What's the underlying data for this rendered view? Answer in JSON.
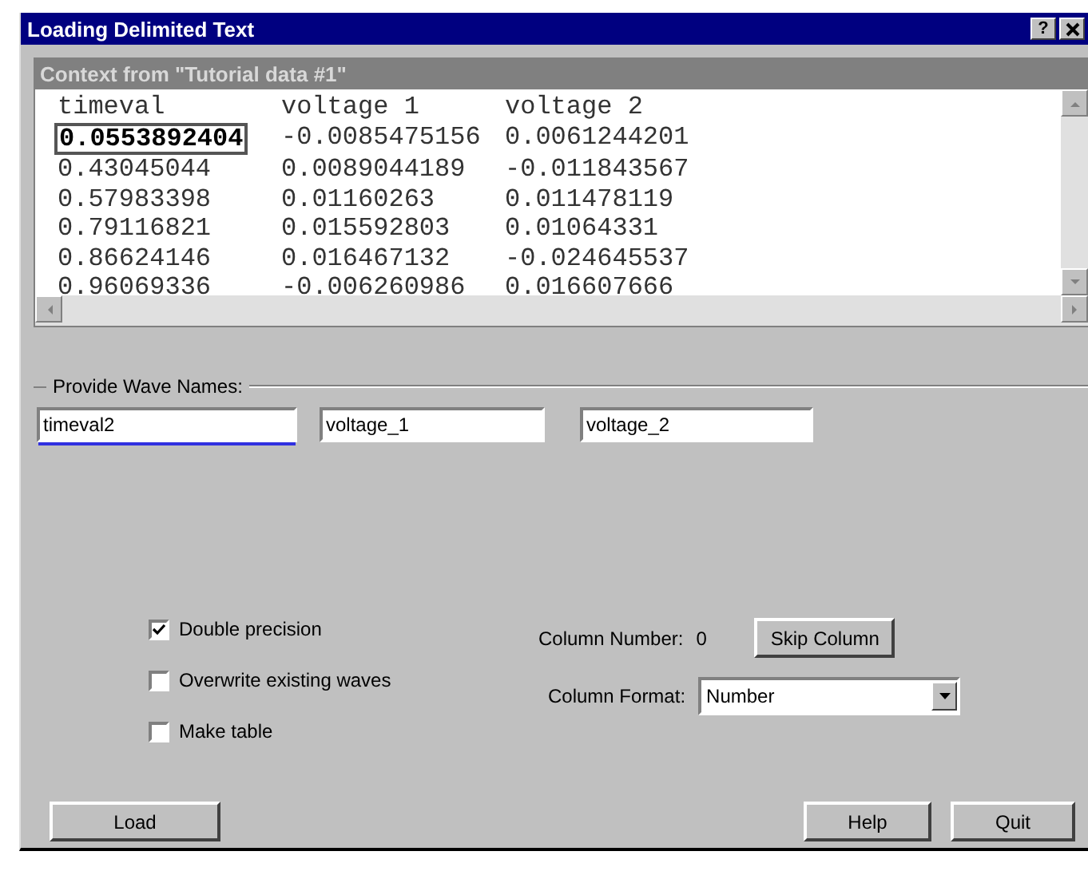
{
  "window": {
    "title": "Loading Delimited Text",
    "help_button": "?"
  },
  "preview": {
    "title": "Context from \"Tutorial data #1\"",
    "rows": [
      {
        "cells": [
          {
            "text": "timeval",
            "selected": false
          },
          {
            "text": "voltage 1",
            "selected": false
          },
          {
            "text": "voltage 2",
            "selected": false
          }
        ]
      },
      {
        "cells": [
          {
            "text": "0.0553892404",
            "selected": true
          },
          {
            "text": "-0.0085475156",
            "selected": false
          },
          {
            "text": "0.0061244201",
            "selected": false
          }
        ]
      },
      {
        "cells": [
          {
            "text": "0.43045044",
            "selected": false
          },
          {
            "text": "0.0089044189",
            "selected": false
          },
          {
            "text": "-0.011843567",
            "selected": false
          }
        ]
      },
      {
        "cells": [
          {
            "text": "0.57983398",
            "selected": false
          },
          {
            "text": "0.01160263",
            "selected": false
          },
          {
            "text": "0.011478119",
            "selected": false
          }
        ]
      },
      {
        "cells": [
          {
            "text": "0.79116821",
            "selected": false
          },
          {
            "text": "0.015592803",
            "selected": false
          },
          {
            "text": "0.01064331",
            "selected": false
          }
        ]
      },
      {
        "cells": [
          {
            "text": "0.86624146",
            "selected": false
          },
          {
            "text": "0.016467132",
            "selected": false
          },
          {
            "text": "-0.024645537",
            "selected": false
          }
        ]
      },
      {
        "cells": [
          {
            "text": "0.96069336",
            "selected": false
          },
          {
            "text": "-0.006260986",
            "selected": false
          },
          {
            "text": "0.016607666",
            "selected": false
          }
        ]
      }
    ]
  },
  "wave_names": {
    "label": "Provide Wave Names:",
    "fields": [
      {
        "value": "timeval2",
        "focused": true
      },
      {
        "value": "voltage_1",
        "focused": false
      },
      {
        "value": "voltage_2",
        "focused": false
      }
    ]
  },
  "options": [
    {
      "label": "Double precision",
      "checked": true
    },
    {
      "label": "Overwrite existing waves",
      "checked": false
    },
    {
      "label": "Make table",
      "checked": false
    }
  ],
  "column_number": {
    "label": "Column Number:",
    "value": "0"
  },
  "skip_button": "Skip Column",
  "column_format": {
    "label": "Column Format:",
    "value": "Number"
  },
  "left_buttons": [
    "Load"
  ],
  "right_buttons": [
    "Help",
    "Quit"
  ]
}
